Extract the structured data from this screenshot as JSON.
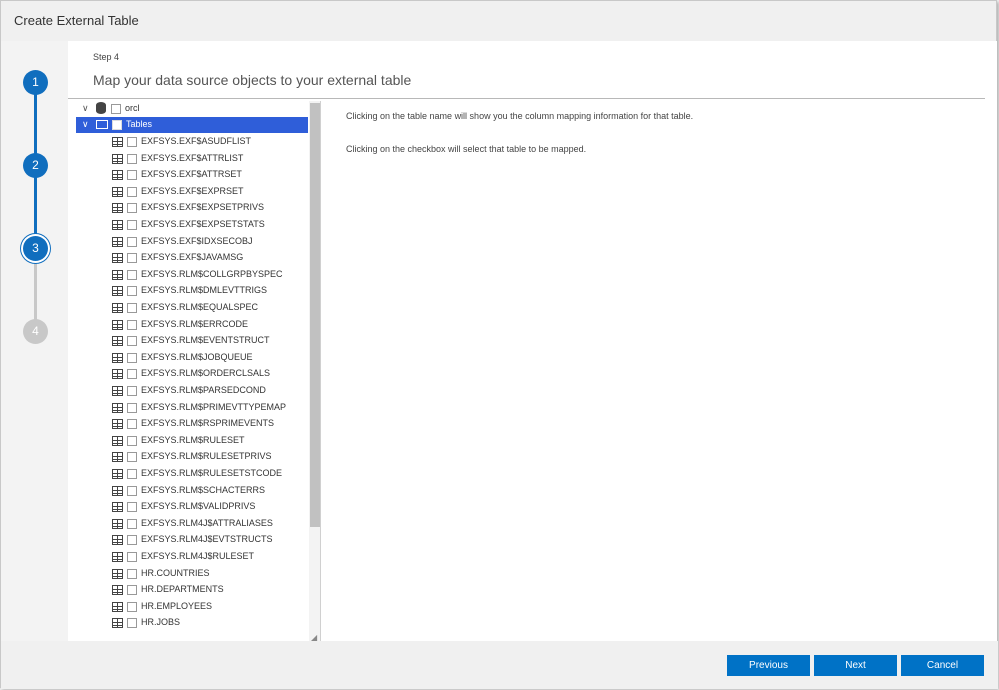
{
  "window": {
    "title": "Create External Table"
  },
  "steps": [
    {
      "number": "1",
      "state": "done"
    },
    {
      "number": "2",
      "state": "done"
    },
    {
      "number": "3",
      "state": "current"
    },
    {
      "number": "4",
      "state": "todo"
    }
  ],
  "main": {
    "step_label": "Step 4",
    "step_title": "Map your data source objects to your external table",
    "info_lines": [
      "Clicking on the table name will show you the column mapping information for that table.",
      "Clicking on the checkbox will select that table to be mapped."
    ]
  },
  "tree": {
    "root": "orcl",
    "folder": "Tables",
    "tables": [
      "EXFSYS.EXF$ASUDFLIST",
      "EXFSYS.EXF$ATTRLIST",
      "EXFSYS.EXF$ATTRSET",
      "EXFSYS.EXF$EXPRSET",
      "EXFSYS.EXF$EXPSETPRIVS",
      "EXFSYS.EXF$EXPSETSTATS",
      "EXFSYS.EXF$IDXSECOBJ",
      "EXFSYS.EXF$JAVAMSG",
      "EXFSYS.RLM$COLLGRPBYSPEC",
      "EXFSYS.RLM$DMLEVTTRIGS",
      "EXFSYS.RLM$EQUALSPEC",
      "EXFSYS.RLM$ERRCODE",
      "EXFSYS.RLM$EVENTSTRUCT",
      "EXFSYS.RLM$JOBQUEUE",
      "EXFSYS.RLM$ORDERCLSALS",
      "EXFSYS.RLM$PARSEDCOND",
      "EXFSYS.RLM$PRIMEVTTYPEMAP",
      "EXFSYS.RLM$RSPRIMEVENTS",
      "EXFSYS.RLM$RULESET",
      "EXFSYS.RLM$RULESETPRIVS",
      "EXFSYS.RLM$RULESETSTCODE",
      "EXFSYS.RLM$SCHACTERRS",
      "EXFSYS.RLM$VALIDPRIVS",
      "EXFSYS.RLM4J$ATTRALIASES",
      "EXFSYS.RLM4J$EVTSTRUCTS",
      "EXFSYS.RLM4J$RULESET",
      "HR.COUNTRIES",
      "HR.DEPARTMENTS",
      "HR.EMPLOYEES",
      "HR.JOBS"
    ]
  },
  "footer": {
    "previous_label": "Previous",
    "next_label": "Next",
    "cancel_label": "Cancel"
  },
  "colors": {
    "accent": "#0072c6",
    "selected": "#2f5ed9",
    "step_done": "#106ebe",
    "step_todo": "#c8c8c8"
  }
}
